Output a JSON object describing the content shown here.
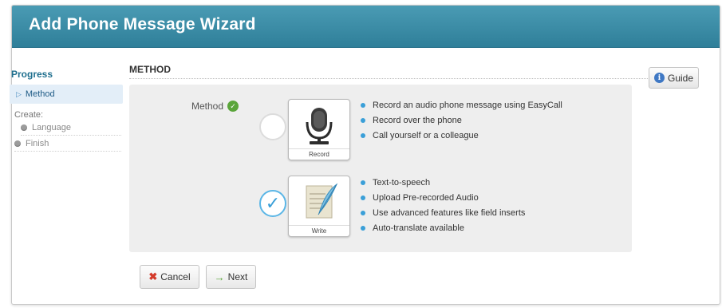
{
  "header": {
    "title": "Add Phone Message Wizard"
  },
  "sidebar": {
    "progress_label": "Progress",
    "method_label": "Method",
    "create_label": "Create:",
    "language_label": "Language",
    "finish_label": "Finish"
  },
  "section": {
    "title": "METHOD"
  },
  "guide": {
    "label": "Guide",
    "icon": "info-icon"
  },
  "method": {
    "label": "Method",
    "options": [
      {
        "caption": "Record",
        "selected": false,
        "features": [
          "Record an audio phone message using EasyCall",
          "Record over the phone",
          "Call yourself or a colleague"
        ]
      },
      {
        "caption": "Write",
        "selected": true,
        "features": [
          "Text-to-speech",
          "Upload Pre-recorded Audio",
          "Use advanced features like field inserts",
          "Auto-translate available"
        ]
      }
    ]
  },
  "footer": {
    "cancel_label": "Cancel",
    "next_label": "Next"
  },
  "colors": {
    "header": "#3a8aa6",
    "accent": "#3a9fd8",
    "success": "#5aa53a",
    "danger": "#d43a2a"
  }
}
